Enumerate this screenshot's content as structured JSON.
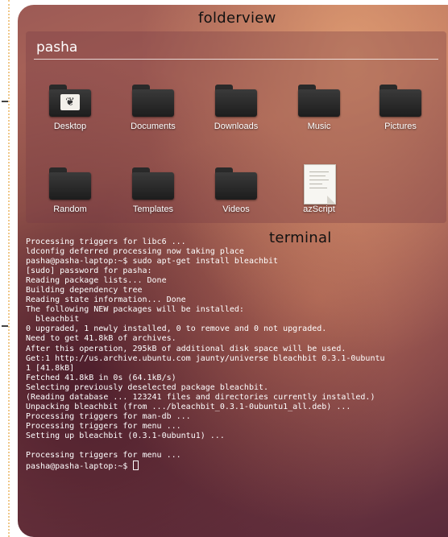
{
  "folderview": {
    "title": "pasha",
    "annotation": "folderview",
    "icons": [
      {
        "label": "Desktop",
        "icon": "desktop-folder-icon",
        "emblem": "❦"
      },
      {
        "label": "Documents",
        "icon": "folder-icon"
      },
      {
        "label": "Downloads",
        "icon": "folder-icon"
      },
      {
        "label": "Music",
        "icon": "folder-icon"
      },
      {
        "label": "Pictures",
        "icon": "folder-icon"
      },
      {
        "label": "Random",
        "icon": "folder-icon"
      },
      {
        "label": "Templates",
        "icon": "folder-icon"
      },
      {
        "label": "Videos",
        "icon": "folder-icon"
      },
      {
        "label": "azScript",
        "icon": "text-document-icon"
      }
    ]
  },
  "terminal": {
    "annotation": "terminal",
    "lines": [
      "Processing triggers for libc6 ...",
      "ldconfig deferred processing now taking place",
      "pasha@pasha-laptop:~$ sudo apt-get install bleachbit",
      "[sudo] password for pasha:",
      "Reading package lists... Done",
      "Building dependency tree",
      "Reading state information... Done",
      "The following NEW packages will be installed:",
      "  bleachbit",
      "0 upgraded, 1 newly installed, 0 to remove and 0 not upgraded.",
      "Need to get 41.8kB of archives.",
      "After this operation, 295kB of additional disk space will be used.",
      "Get:1 http://us.archive.ubuntu.com jaunty/universe bleachbit 0.3.1-0ubuntu",
      "1 [41.8kB]",
      "Fetched 41.8kB in 0s (64.1kB/s)",
      "Selecting previously deselected package bleachbit.",
      "(Reading database ... 123241 files and directories currently installed.)",
      "Unpacking bleachbit (from .../bleachbit_0.3.1-0ubuntu1_all.deb) ...",
      "Processing triggers for man-db ...",
      "Processing triggers for menu ...",
      "Setting up bleachbit (0.3.1-0ubuntu1) ...",
      "",
      "Processing triggers for menu ...",
      "pasha@pasha-laptop:~$ "
    ]
  }
}
